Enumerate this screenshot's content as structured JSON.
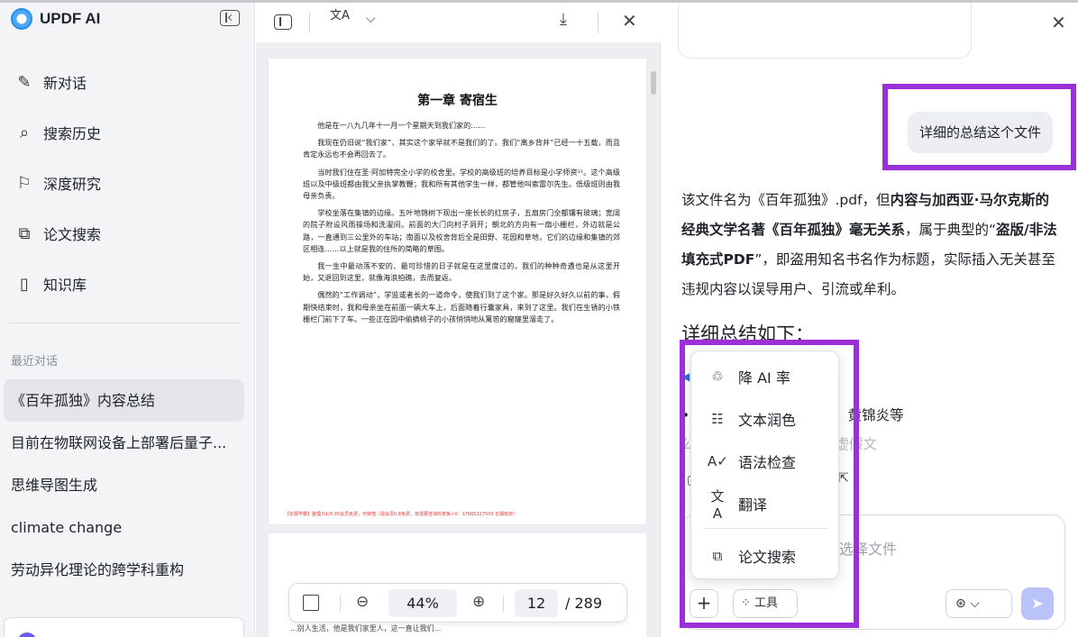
{
  "brand": {
    "name": "UPDF AI"
  },
  "sidebar": {
    "nav": [
      {
        "label": "新对话",
        "icon": "✎"
      },
      {
        "label": "搜索历史",
        "icon": "⌕"
      },
      {
        "label": "深度研究",
        "icon": "⚐"
      },
      {
        "label": "论文搜索",
        "icon": "⧉"
      },
      {
        "label": "知识库",
        "icon": "▯"
      }
    ],
    "recent_title": "最近对话",
    "recent": [
      "《百年孤独》内容总结",
      "目前在物联网设备上部署后量子...",
      "思维导图生成",
      "climate change",
      "劳动异化理论的跨学科重构"
    ]
  },
  "viewer": {
    "translate_glyph": "文A",
    "page_title": "第一章 寄宿生",
    "paragraphs": [
      "他是在一八九几年十一月一个星期天到我们家的……",
      "我现在仍旧说“我们家”，其实这个家早就不是我们的了。我们“离乡背井”已经一十五载，而且肯定永远也不会再回去了。",
      "当时我们住在圣·阿加特完全小学的校舍里。学校的高级班的培养目标是小学师资¹¹。这个高级班以及中级班都由我父亲执掌教鞭；我和所有其他学生一样，都管他叫索雷尔先生。低级班则由我母亲负责。",
      "学校坐落在集镇的边缘。五叶地锦树下现出一座长长的红房子，五扇房门全都镶有玻璃；宽阔的院子附设风雨操场和洗濯间。前面的大门向村子洞开；朝北的方向有一扇小栅栏，外边就是公路，一直通到三公里外的车站；南面以及校舍背后全是田野、花园和草地，它们的边缘和集镇的郊区相连……以上就是我的住所的简略的草图。",
      "我一生中最动荡不安的、最可珍惜的日子就是在这里度过的，我们的种种奇遇也是从这里开始，又退回到这里，就像海浪拍礁，去而复返。",
      "偶然的“工作调动”，学监或者长的一道命令，使我们到了这个家。那是好久好久以前的事，假期快结束时，我和母亲坐在前面一辆大车上，后面随着行囊家具，来到了这里。我们在生锈的小铁栅栏门前下了车。一些正在园中偷摘桃子的小孩悄悄地从篱笆的窟窿里溜走了。"
    ],
    "footer": "【长郡学霸】整理为1/0.35会员免费，可转借（需会员0.8免费，有需要咨询的老板+V：17665227505 长期有效）",
    "page2_text": "...别人生活，他是我们家里人，这一直让我们...",
    "zoom": "44%",
    "page_current": "12",
    "page_total": "/ 289"
  },
  "chat": {
    "user_message": "详细的总结这个文件",
    "answer": {
      "part1": "该文件名为《百年孤独》.pdf，但",
      "bold1": "内容与加西亚·马尔克斯的经典文学名著《百年孤独》毫无关系",
      "part2": "，属于典型的“",
      "bold2": "盗版/非法填充式PDF",
      "part3": "”，即盗用知名书名作为标题，实际插入无关甚至违规内容以误导用户、引流或牟利。"
    },
    "summary_heading": "详细总结如下：",
    "bullet_text": "•                              音或正规译本（如范晔、黄锦炎等",
    "bullet_faded": "                                  公平竞筹改，实带广告的虚假文",
    "input_placeholder": "选择文件",
    "plus_label": "+",
    "tools_label": "工具",
    "tools_icon": "⁘",
    "model_icon": "⊛",
    "send_icon": "➤"
  },
  "popup": {
    "items": [
      {
        "label": "降 AI 率",
        "icon": "♲"
      },
      {
        "label": "文本润色",
        "icon": "☷"
      },
      {
        "label": "语法检查",
        "icon": "A✓"
      },
      {
        "label": "翻译",
        "icon": "文A"
      },
      {
        "label": "论文搜索",
        "icon": "⧉"
      }
    ]
  },
  "colors": {
    "highlight": "#9b30d9",
    "send_button": "#b9c3f7",
    "sidebar_bg": "#f3f4f6"
  }
}
